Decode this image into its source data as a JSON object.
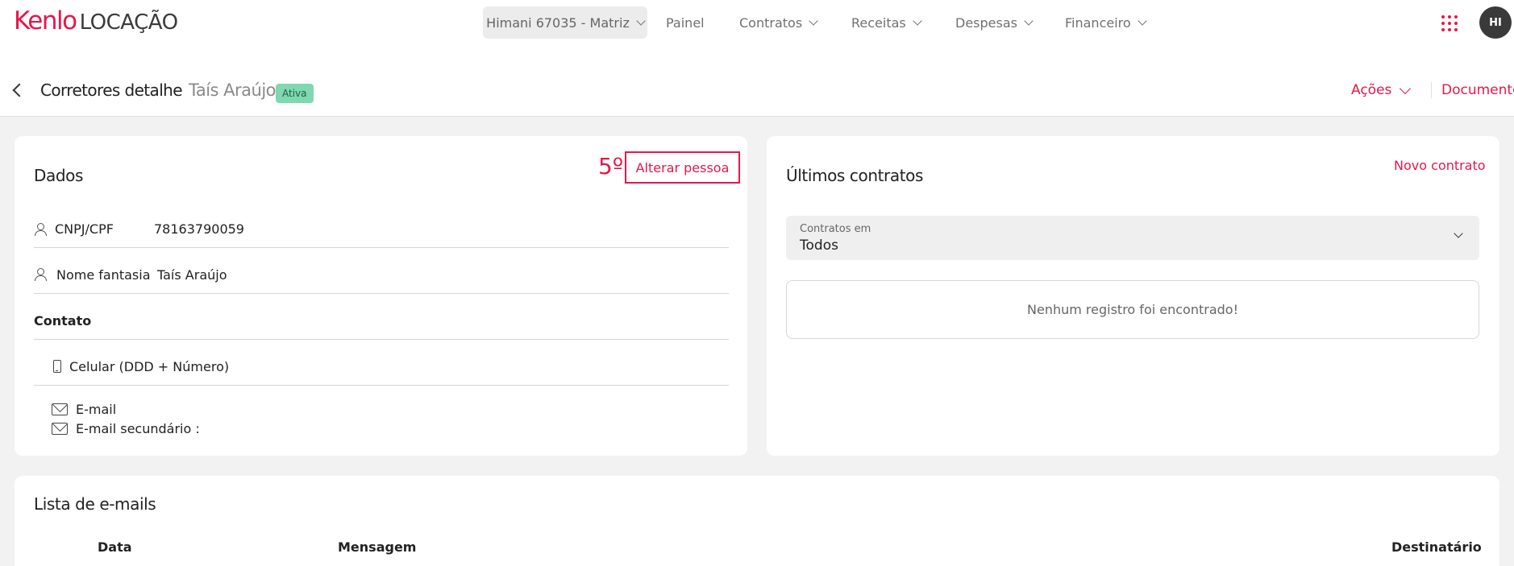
{
  "app": {
    "brand": "Kenlo",
    "product": "LOCAÇÃO"
  },
  "nav": {
    "branch": "Himani 67035 - Matriz",
    "items": [
      "Painel",
      "Contratos",
      "Receitas",
      "Despesas",
      "Financeiro"
    ],
    "avatar_initials": "HI"
  },
  "header": {
    "title": "Corretores detalhe",
    "person_name": "Taís Araújo",
    "status_badge": "Ativa",
    "actions_label": "Ações",
    "documents_label": "Documentos"
  },
  "dados": {
    "title": "Dados",
    "step_marker": "5º",
    "alter_button": "Alterar pessoa",
    "cnpj_label": "CNPJ/CPF",
    "cnpj_value": "78163790059",
    "nome_label": "Nome fantasia",
    "nome_value": "Taís Araújo",
    "contato_heading": "Contato",
    "celular_label": "Celular (DDD + Número)",
    "email_label": "E-mail",
    "email_secundario_label": "E-mail secundário :"
  },
  "contratos": {
    "title": "Últimos contratos",
    "new_button": "Novo contrato",
    "select_label": "Contratos em",
    "select_value": "Todos",
    "empty_message": "Nenhum registro foi encontrado!"
  },
  "emails": {
    "title": "Lista de e-mails",
    "columns": [
      "Data",
      "Mensagem",
      "Destinatário"
    ]
  },
  "colors": {
    "accent": "#e6174a",
    "badge_bg": "#7fd8b0",
    "page_bg": "#f2f2f2"
  }
}
